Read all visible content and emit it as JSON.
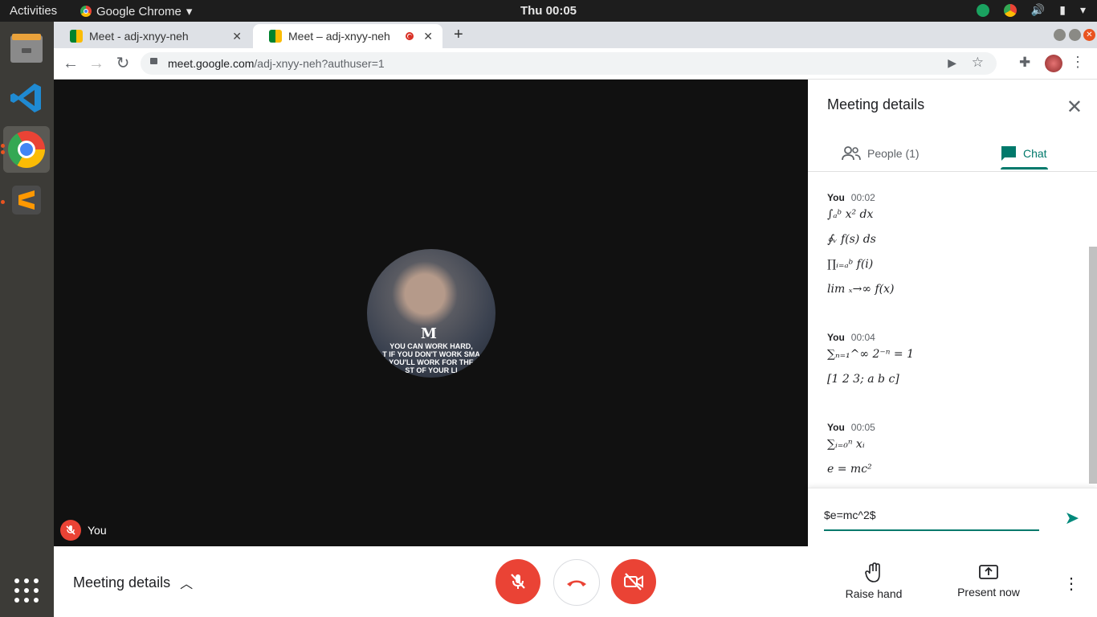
{
  "system": {
    "activities": "Activities",
    "app_menu": "Google Chrome",
    "clock": "Thu 00:05"
  },
  "browser": {
    "tabs": [
      {
        "label": "Meet - adj-xnyy-neh",
        "active": false
      },
      {
        "label": "Meet – adj-xnyy-neh",
        "active": true,
        "recording": true
      }
    ],
    "url_host": "meet.google.com",
    "url_path": "/adj-xnyy-neh?authuser=1"
  },
  "meet": {
    "avatar_logo": "M",
    "avatar_quote": [
      "YOU CAN WORK HARD,",
      "T IF YOU DON'T WORK SMA",
      "YOU'LL WORK FOR THE",
      "ST OF YOUR LI"
    ],
    "self_label": "You",
    "meeting_details_label": "Meeting details",
    "raise_hand_label": "Raise hand",
    "present_label": "Present now"
  },
  "panel": {
    "title": "Meeting details",
    "tabs": [
      {
        "label": "People (1)",
        "icon": "people-icon",
        "active": false
      },
      {
        "label": "Chat",
        "icon": "chat-icon",
        "active": true
      }
    ],
    "messages": [
      {
        "sender": "You",
        "time": "00:02",
        "lines": [
          "∫ₐᵇ x² dx",
          "∮ᵥ f(s) ds",
          "∏ᵢ₌ₐᵇ f(i)",
          "lim ₓ→∞ f(x)"
        ]
      },
      {
        "sender": "You",
        "time": "00:04",
        "lines": [
          "∑ₙ₌₁^∞ 2⁻ⁿ = 1",
          "[1 2 3; a b c]"
        ]
      },
      {
        "sender": "You",
        "time": "00:05",
        "lines": [
          "∑ᵢ₌₀ⁿ xᵢ",
          "e = mc²"
        ]
      }
    ],
    "composer_value": "$e=mc^2$"
  },
  "colors": {
    "accent": "#00796b",
    "danger": "#ea4335",
    "stage_bg": "#111111"
  }
}
